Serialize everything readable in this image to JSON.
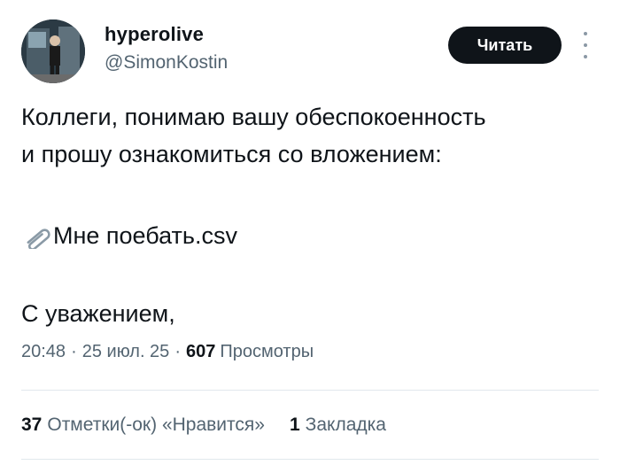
{
  "author": {
    "display_name": "hyperolive",
    "handle": "@SimonKostin"
  },
  "header": {
    "read_button_label": "Читать",
    "more_icon": "more-vertical-icon"
  },
  "tweet": {
    "line1": "Коллеги, понимаю вашу обеспокоенность",
    "line2": "и прошу ознакомиться со вложением:",
    "attachment_icon": "paperclip-icon",
    "attachment_name": "Мне поебать.csv",
    "signoff": "С уважением,"
  },
  "meta": {
    "time": "20:48",
    "separator": "·",
    "date": "25 июл. 25",
    "views_count": "607",
    "views_label": "Просмотры"
  },
  "stats": {
    "likes_count": "37",
    "likes_label": "Отметки(-ок) «Нравится»",
    "bookmarks_count": "1",
    "bookmarks_label": "Закладка"
  }
}
